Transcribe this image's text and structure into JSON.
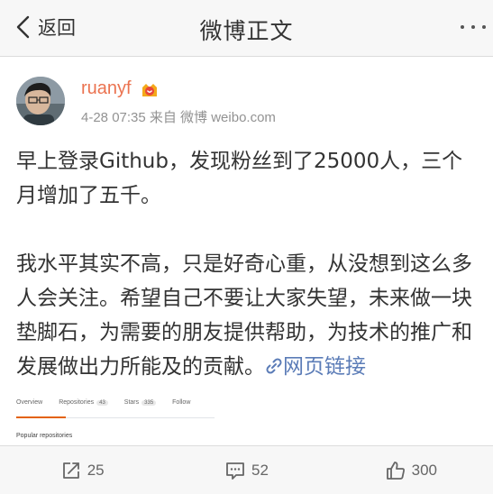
{
  "nav": {
    "back_label": "返回",
    "title": "微博正文"
  },
  "post": {
    "username": "ruanyf",
    "meta": "4-28 07:35 来自 微博 weibo.com",
    "paragraph1": "早上登录Github，发现粉丝到了25000人，三个月增加了五千。",
    "paragraph2": "我水平其实不高，只是好奇心重，从没想到这么多人会关注。希望自己不要让大家失望，未来做一块垫脚石，为需要的朋友提供帮助，为技术的推广和发展做出力所能及的贡献。",
    "link_label": "网页链接"
  },
  "embed": {
    "tabs": [
      {
        "label": "Overview",
        "count": ""
      },
      {
        "label": "Repositories",
        "count": "43"
      },
      {
        "label": "Stars",
        "count": "335"
      },
      {
        "label": "Follow",
        "count": ""
      }
    ],
    "cut_text": "Popular repositories"
  },
  "actions": {
    "repost_count": "25",
    "comment_count": "52",
    "like_count": "300"
  },
  "colors": {
    "username": "#eb7350",
    "link": "#5b7cb7",
    "meta": "#929292"
  }
}
